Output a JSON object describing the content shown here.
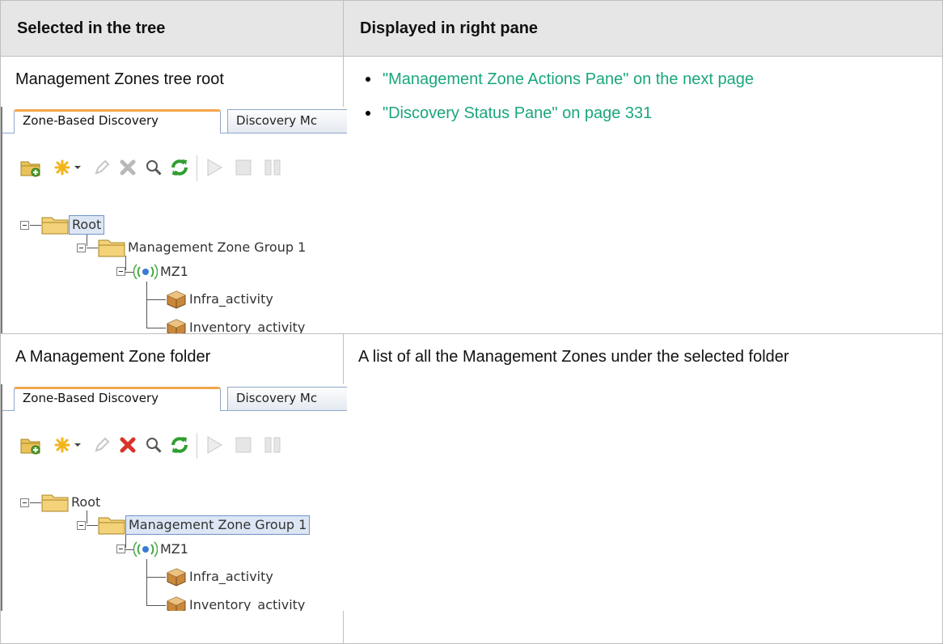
{
  "table": {
    "headers": [
      "Selected in the tree",
      "Displayed in right pane"
    ],
    "rows": [
      {
        "selected": "Management Zones tree root",
        "links": [
          "\"Management Zone Actions Pane\" on the next page",
          "\"Discovery Status Pane\" on page 331"
        ],
        "screenshot": {
          "tabs": [
            "Zone-Based Discovery",
            "Discovery Mc"
          ],
          "tree": {
            "root": "Root",
            "group": "Management Zone Group 1",
            "zone": "MZ1",
            "activities": [
              "Infra_activity",
              "Inventory_activity"
            ]
          },
          "selected_node": "root"
        }
      },
      {
        "selected": "A Management Zone folder",
        "description": "A list of all the Management Zones under the selected folder",
        "screenshot": {
          "tabs": [
            "Zone-Based Discovery",
            "Discovery Mc"
          ],
          "tree": {
            "root": "Root",
            "group": "Management Zone Group 1",
            "zone": "MZ1",
            "activities": [
              "Infra_activity",
              "Inventory_activity"
            ]
          },
          "selected_node": "group"
        }
      }
    ]
  },
  "toolbar_icons": [
    "new-folder-icon",
    "new-item-icon",
    "dropdown-arrow-icon",
    "edit-icon",
    "delete-icon",
    "search-icon",
    "refresh-icon",
    "play-icon",
    "stop-icon",
    "pause-icon"
  ],
  "colors": {
    "link": "#1aa67d",
    "header_bg": "#e6e6e6",
    "tab_accent": "#f2a64a"
  }
}
